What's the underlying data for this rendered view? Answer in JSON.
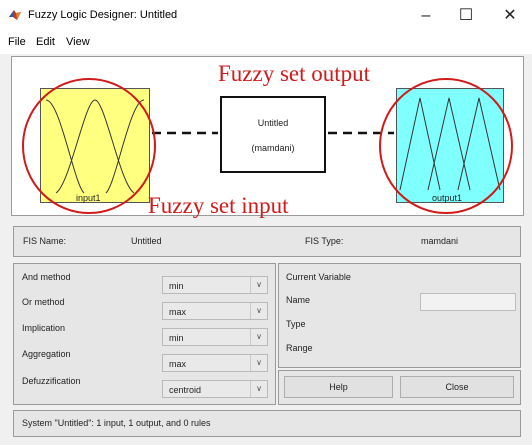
{
  "window": {
    "title": "Fuzzy Logic Designer: Untitled"
  },
  "menu": {
    "items": [
      "File",
      "Edit",
      "View"
    ]
  },
  "diagram": {
    "input_label": "input1",
    "output_label": "output1",
    "system_name": "Untitled",
    "system_type": "(mamdani)",
    "annotation_output": "Fuzzy set output",
    "annotation_input": "Fuzzy set input",
    "input_color": "#ffff80",
    "output_color": "#80ffff",
    "annotation_color": "#d11a1a"
  },
  "fis": {
    "name_label": "FIS Name:",
    "name_value": "Untitled",
    "type_label": "FIS Type:",
    "type_value": "mamdani"
  },
  "methods": [
    {
      "label": "And method",
      "value": "min"
    },
    {
      "label": "Or method",
      "value": "max"
    },
    {
      "label": "Implication",
      "value": "min"
    },
    {
      "label": "Aggregation",
      "value": "max"
    },
    {
      "label": "Defuzzification",
      "value": "centroid"
    }
  ],
  "current_variable": {
    "title": "Current Variable",
    "name_label": "Name",
    "type_label": "Type",
    "range_label": "Range",
    "name_value": ""
  },
  "buttons": {
    "help": "Help",
    "close": "Close"
  },
  "status": "System \"Untitled\": 1 input, 1 output, and 0 rules"
}
